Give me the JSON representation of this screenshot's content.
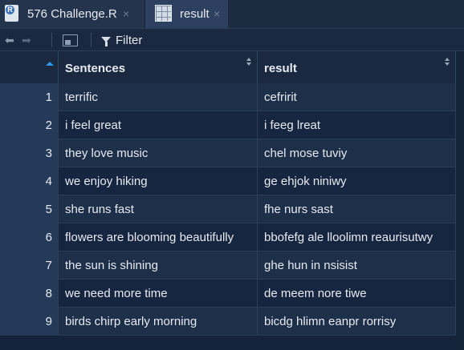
{
  "tabs": [
    {
      "label": "576 Challenge.R",
      "close": "×"
    },
    {
      "label": "result",
      "close": "×"
    }
  ],
  "toolbar": {
    "back_icon": "arrow-left-icon",
    "forward_icon": "arrow-right-icon",
    "popout_icon": "popout-window-icon",
    "filter_icon": "funnel-icon",
    "filter_label": "Filter"
  },
  "table": {
    "columns": [
      "Sentences",
      "result"
    ],
    "rows": [
      {
        "index": "1",
        "sentence": "terrific",
        "result": "cefririt"
      },
      {
        "index": "2",
        "sentence": "i feel great",
        "result": "i feeg lreat"
      },
      {
        "index": "3",
        "sentence": "they love music",
        "result": "chel mose tuviy"
      },
      {
        "index": "4",
        "sentence": "we enjoy hiking",
        "result": "ge ehjok niniwy"
      },
      {
        "index": "5",
        "sentence": "she runs fast",
        "result": "fhe nurs sast"
      },
      {
        "index": "6",
        "sentence": "flowers are blooming beautifully",
        "result": "bbofefg ale lloolimn reaurisutwy"
      },
      {
        "index": "7",
        "sentence": "the sun is shining",
        "result": "ghe hun in nsisist"
      },
      {
        "index": "8",
        "sentence": "we need more time",
        "result": "de meem nore tiwe"
      },
      {
        "index": "9",
        "sentence": "birds chirp early morning",
        "result": "bicdg hlimn eanpr rorrisy"
      }
    ]
  },
  "colors": {
    "background": "#15233a",
    "header": "#1b2940",
    "row_odd": "#1e2f49",
    "row_even": "#172640",
    "index_col": "#243a58",
    "sort_accent": "#2a97e8"
  }
}
